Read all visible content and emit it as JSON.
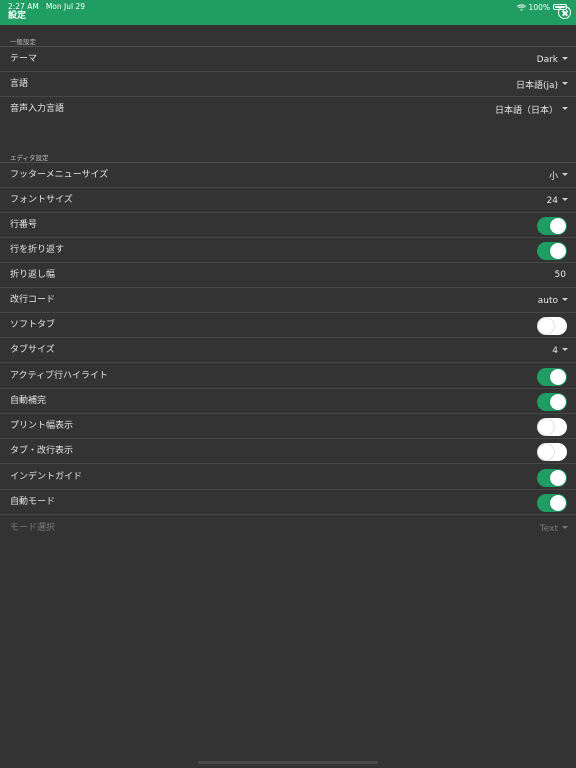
{
  "status_bar": {
    "time": "2:27 AM",
    "date": "Mon Jul 29",
    "battery": "100%"
  },
  "header": {
    "title": "設定"
  },
  "sections": {
    "general": {
      "label": "一般設定",
      "theme": {
        "label": "テーマ",
        "value": "Dark"
      },
      "language": {
        "label": "言語",
        "value": "日本語(ja)"
      },
      "voice_language": {
        "label": "音声入力言語",
        "value": "日本語（日本）"
      }
    },
    "editor": {
      "label": "エディタ設定",
      "footer_menu_size": {
        "label": "フッターメニューサイズ",
        "value": "小"
      },
      "font_size": {
        "label": "フォントサイズ",
        "value": "24"
      },
      "line_numbers": {
        "label": "行番号",
        "on": true
      },
      "wrap_lines": {
        "label": "行を折り返す",
        "on": true
      },
      "wrap_width": {
        "label": "折り返し幅",
        "value": "50"
      },
      "newline_code": {
        "label": "改行コード",
        "value": "auto"
      },
      "soft_tab": {
        "label": "ソフトタブ",
        "on": false
      },
      "tab_size": {
        "label": "タブサイズ",
        "value": "4"
      },
      "active_line_highlight": {
        "label": "アクティブ行ハイライト",
        "on": true
      },
      "autocomplete": {
        "label": "自動補完",
        "on": true
      },
      "print_width": {
        "label": "プリント幅表示",
        "on": false
      },
      "show_tabs_newlines": {
        "label": "タブ・改行表示",
        "on": false
      },
      "indent_guide": {
        "label": "インデントガイド",
        "on": true
      },
      "auto_mode": {
        "label": "自動モード",
        "on": true
      },
      "mode_select": {
        "label": "モード選択",
        "value": "Text"
      }
    }
  },
  "colors": {
    "accent": "#1f9d63",
    "background": "#333333",
    "divider": "#474747"
  }
}
